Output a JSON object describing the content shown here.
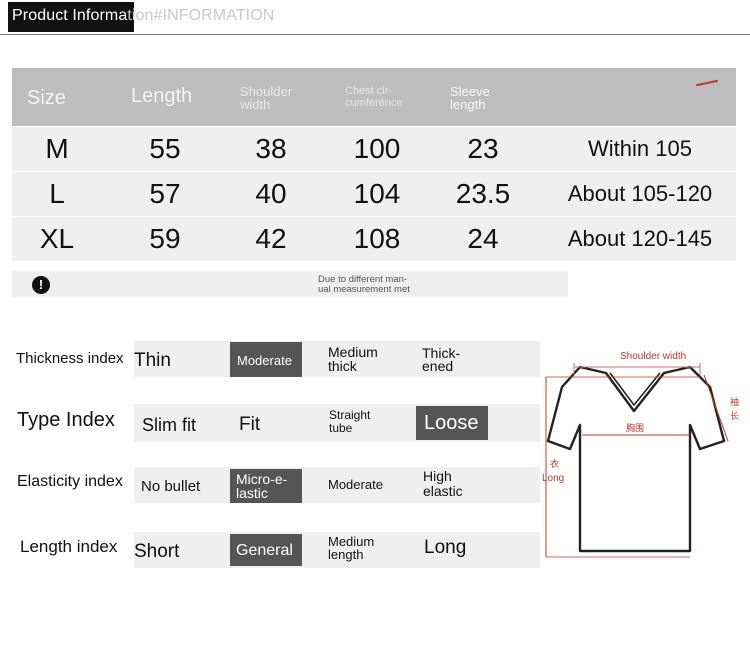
{
  "header": {
    "title_main": "Product Informa",
    "title_rest": "tion#INFORMATION"
  },
  "size_table": {
    "columns": [
      {
        "label": "Size"
      },
      {
        "label": "Length"
      },
      {
        "label_line1": "Shoulder",
        "label_line2": "width"
      },
      {
        "label_line1": "Chest cir-",
        "label_line2": "cumference"
      },
      {
        "label_line1": "Sleeve",
        "label_line2": "length"
      }
    ],
    "rows": [
      {
        "size": "M",
        "length": "55",
        "shoulder": "38",
        "chest": "100",
        "sleeve": "23",
        "fit": "Within 105"
      },
      {
        "size": "L",
        "length": "57",
        "shoulder": "40",
        "chest": "104",
        "sleeve": "23.5",
        "fit": "About 105-120"
      },
      {
        "size": "XL",
        "length": "59",
        "shoulder": "42",
        "chest": "108",
        "sleeve": "24",
        "fit": "About 120-145"
      }
    ],
    "note_icon": "!",
    "note_line1": "Due to different man-",
    "note_line2": "ual measurement met"
  },
  "indexes": {
    "thickness": {
      "label": "Thickness index",
      "options": [
        {
          "l1": "Thin"
        },
        {
          "l1": "Moderate",
          "selected": true
        },
        {
          "l1": "Medium",
          "l2": "thick"
        },
        {
          "l1": "Thick-",
          "l2": "ened"
        }
      ]
    },
    "type": {
      "label": "Type Index",
      "options": [
        {
          "l1": "Slim fit"
        },
        {
          "l1": "Fit"
        },
        {
          "l1": "Straight",
          "l2": "tube"
        },
        {
          "l1": "Loose",
          "selected": true
        }
      ]
    },
    "elasticity": {
      "label": "Elasticity index",
      "options": [
        {
          "l1": "No bullet"
        },
        {
          "l1": "Micro-e-",
          "l2": "lastic",
          "selected": true
        },
        {
          "l1": "Moderate"
        },
        {
          "l1": "High",
          "l2": "elastic"
        }
      ]
    },
    "length": {
      "label": "Length index",
      "options": [
        {
          "l1": "Short"
        },
        {
          "l1": "General",
          "selected": true
        },
        {
          "l1": "Medium",
          "l2": "length"
        },
        {
          "l1": "Long"
        }
      ]
    }
  },
  "diagram": {
    "shoulder_label": "Shoulder width",
    "chest_label": "胸围",
    "length_cn": "衣",
    "length_en": "Long",
    "sleeve_cn_1": "袖",
    "sleeve_cn_2": "长",
    "icon": "tshirt-outline-icon",
    "accent_color": "#c0392b"
  }
}
